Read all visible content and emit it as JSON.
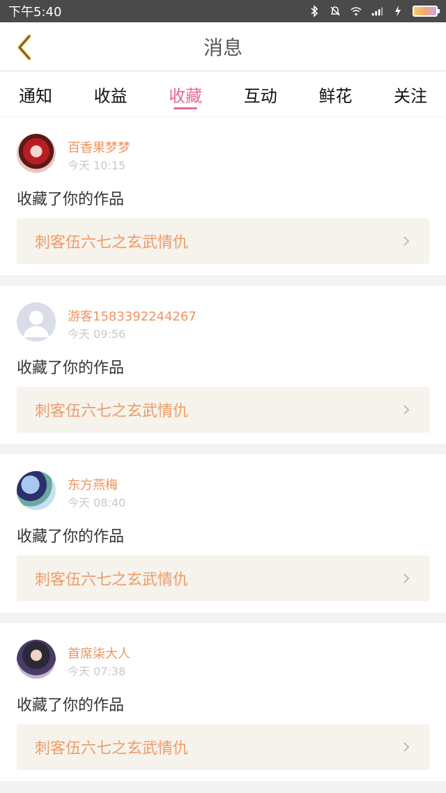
{
  "status_bar": {
    "time": "下午5:40"
  },
  "header": {
    "title": "消息",
    "back_icon": "chevron-left-icon"
  },
  "tabs": [
    {
      "label": "通知",
      "active": false
    },
    {
      "label": "收益",
      "active": false
    },
    {
      "label": "收藏",
      "active": true
    },
    {
      "label": "互动",
      "active": false
    },
    {
      "label": "鲜花",
      "active": false
    },
    {
      "label": "关注",
      "active": false
    }
  ],
  "messages": [
    {
      "user": "百香果梦梦",
      "time": "今天 10:15",
      "action": "收藏了你的作品",
      "work": "刺客伍六七之玄武情仇"
    },
    {
      "user": "游客1583392244267",
      "time": "今天 09:56",
      "action": "收藏了你的作品",
      "work": "刺客伍六七之玄武情仇"
    },
    {
      "user": "东方燕梅",
      "time": "今天 08:40",
      "action": "收藏了你的作品",
      "work": "刺客伍六七之玄武情仇"
    },
    {
      "user": "首席柒大人",
      "time": "今天 07:38",
      "action": "收藏了你的作品",
      "work": "刺客伍六七之玄武情仇"
    }
  ],
  "colors": {
    "accent": "#ea6a9a",
    "name": "#f0935e",
    "work": "#ef9b69",
    "back_icon": "#e0ad2f"
  }
}
